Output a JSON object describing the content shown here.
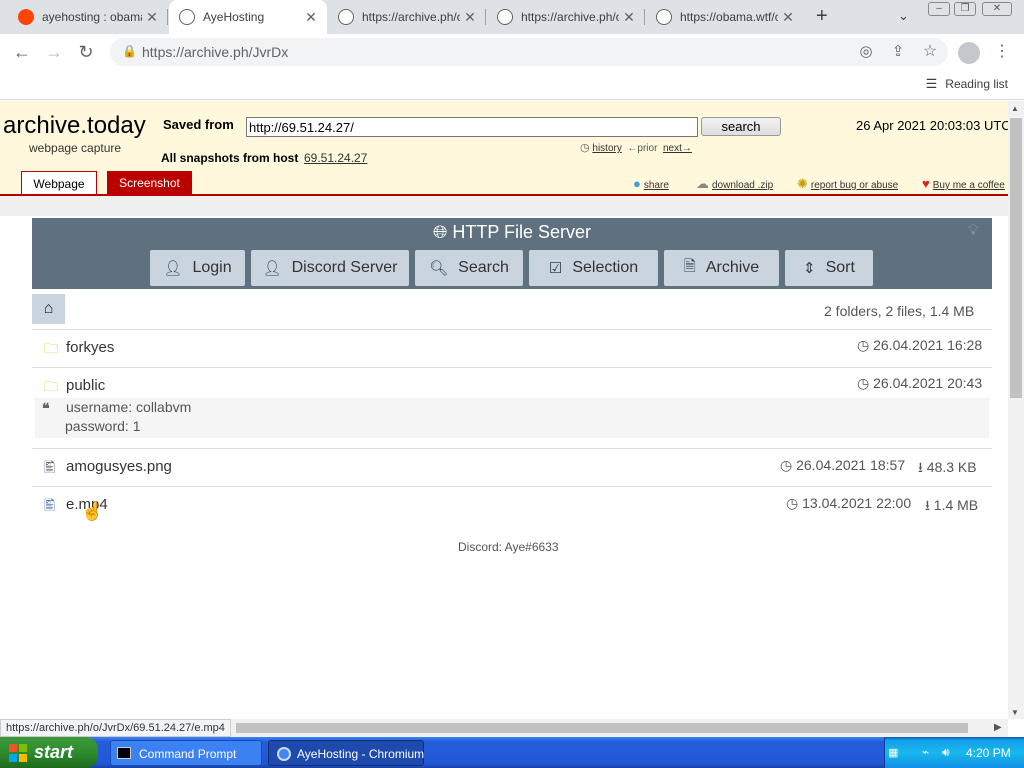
{
  "browser": {
    "tabs": [
      {
        "title": "ayehosting : obama",
        "favicon": "reddit-icon",
        "active": false
      },
      {
        "title": "AyeHosting",
        "favicon": "globe-icon",
        "active": true
      },
      {
        "title": "https://archive.ph/o",
        "favicon": "globe-icon",
        "active": false
      },
      {
        "title": "https://archive.ph/o",
        "favicon": "globe-icon",
        "active": false
      },
      {
        "title": "https://obama.wtf/c",
        "favicon": "globe-icon",
        "active": false
      }
    ],
    "url": "https://archive.ph/JvrDx",
    "reading_list": "Reading list",
    "status_url": "https://archive.ph/o/JvrDx/69.51.24.27/e.mp4"
  },
  "archive": {
    "brand": "archive.today",
    "brand_sub": "webpage capture",
    "saved_from_label": "Saved from",
    "saved_from_value": "http://69.51.24.27/",
    "search_label": "search",
    "date": "26 Apr 2021 20:03:03 UTC",
    "history": "history",
    "prior": "←prior",
    "next": "next→",
    "snapshots_label": "All snapshots  from host",
    "host": "69.51.24.27",
    "tab_webpage": "Webpage",
    "tab_screenshot": "Screenshot",
    "tools": {
      "share": "share",
      "download": "download .zip",
      "report": "report bug or abuse",
      "coffee": "Buy me a coffee"
    }
  },
  "fileserver": {
    "title": "HTTP File Server",
    "buttons": {
      "login": "Login",
      "discord": "Discord Server",
      "search": "Search",
      "selection": "Selection",
      "archive": "Archive",
      "sort": "Sort"
    },
    "summary": "2 folders, 2 files, 1.4 MB",
    "items": [
      {
        "name": "forkyes",
        "type": "folder",
        "date": "26.04.2021 16:28",
        "size": ""
      },
      {
        "name": "public",
        "type": "folder",
        "date": "26.04.2021 20:43",
        "size": "",
        "comment": [
          "username: collabvm",
          "password: 1"
        ]
      },
      {
        "name": "amogusyes.png",
        "type": "file",
        "date": "26.04.2021 18:57",
        "size": "48.3 KB"
      },
      {
        "name": "e.mp4",
        "type": "file",
        "date": "13.04.2021 22:00",
        "size": "1.4 MB"
      }
    ],
    "footer": "Discord: Aye#6633"
  },
  "taskbar": {
    "start": "start",
    "items": [
      "Command Prompt",
      "AyeHosting - Chromium"
    ],
    "clock": "4:20 PM"
  }
}
